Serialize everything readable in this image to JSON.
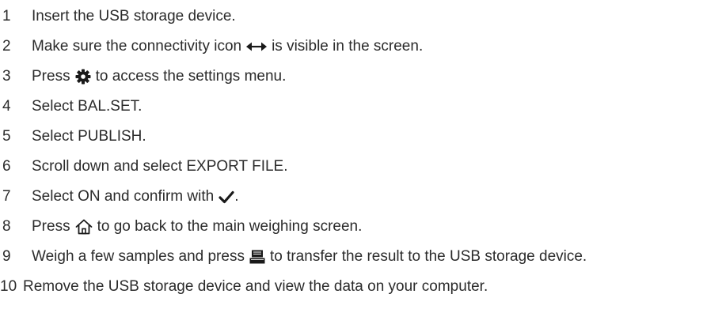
{
  "steps": [
    {
      "num": "1",
      "text": "Insert the USB storage device."
    },
    {
      "num": "2",
      "before": "Make sure the connectivity icon",
      "icon": "double-arrow-icon",
      "after": "is visible in the screen."
    },
    {
      "num": "3",
      "before": "Press",
      "icon": "gear-icon",
      "after": "to access the settings menu."
    },
    {
      "num": "4",
      "text": "Select BAL.SET."
    },
    {
      "num": "5",
      "text": "Select PUBLISH."
    },
    {
      "num": "6",
      "text": "Scroll down and select EXPORT FILE."
    },
    {
      "num": "7",
      "before": "Select ON and confirm with",
      "icon": "checkmark-icon",
      "after": "."
    },
    {
      "num": "8",
      "before": "Press",
      "icon": "home-icon",
      "after": "to go back to the main weighing screen."
    },
    {
      "num": "9",
      "before": "Weigh a few samples and press",
      "icon": "printer-icon",
      "after": "to transfer the result to the USB storage device."
    },
    {
      "num": "10",
      "text": "Remove the USB storage device and view the data on your computer."
    }
  ]
}
